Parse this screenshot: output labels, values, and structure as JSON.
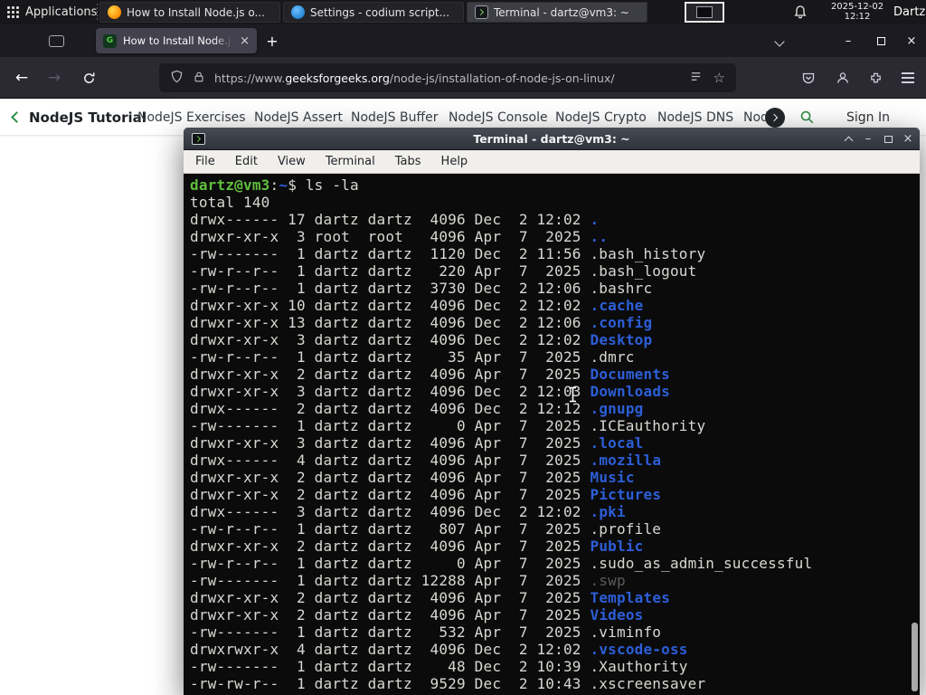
{
  "panel": {
    "applications": "Applications",
    "windows": [
      {
        "title": "How to Install Node.js o..."
      },
      {
        "title": "Settings - codium script..."
      },
      {
        "title": "Terminal - dartz@vm3: ~"
      }
    ],
    "date": "2025-12-02",
    "time": "12:12",
    "user": "Dartz"
  },
  "browser": {
    "tab": {
      "title": "How to Install Node.js on",
      "favicon_letter": "G"
    },
    "url": {
      "scheme": "https://www.",
      "domain": "geeksforgeeks.org",
      "path": "/node-js/installation-of-node-js-on-linux/"
    }
  },
  "site_nav": {
    "items": [
      "NodeJS Tutorial",
      "NodeJS Exercises",
      "NodeJS Assert",
      "NodeJS Buffer",
      "NodeJS Console",
      "NodeJS Crypto",
      "NodeJS DNS",
      "Node"
    ],
    "sign_in": "Sign In"
  },
  "terminal": {
    "title": "Terminal - dartz@vm3: ~",
    "menu": [
      "File",
      "Edit",
      "View",
      "Terminal",
      "Tabs",
      "Help"
    ],
    "lines": [
      [
        [
          "dartz@vm3",
          "g"
        ],
        [
          ":",
          ""
        ],
        [
          "~",
          "b"
        ],
        [
          "$ ls -la",
          ""
        ]
      ],
      [
        [
          "total 140",
          ""
        ]
      ],
      [
        [
          "drwx------ 17 dartz dartz  4096 Dec  2 12:02 ",
          ""
        ],
        [
          ".",
          "b"
        ]
      ],
      [
        [
          "drwxr-xr-x  3 root  root   4096 Apr  7  2025 ",
          ""
        ],
        [
          "..",
          "b"
        ]
      ],
      [
        [
          "-rw-------  1 dartz dartz  1120 Dec  2 11:56 .bash_history",
          ""
        ]
      ],
      [
        [
          "-rw-r--r--  1 dartz dartz   220 Apr  7  2025 .bash_logout",
          ""
        ]
      ],
      [
        [
          "-rw-r--r--  1 dartz dartz  3730 Dec  2 12:06 .bashrc",
          ""
        ]
      ],
      [
        [
          "drwxr-xr-x 10 dartz dartz  4096 Dec  2 12:02 ",
          ""
        ],
        [
          ".cache",
          "b"
        ]
      ],
      [
        [
          "drwxr-xr-x 13 dartz dartz  4096 Dec  2 12:06 ",
          ""
        ],
        [
          ".config",
          "b"
        ]
      ],
      [
        [
          "drwxr-xr-x  3 dartz dartz  4096 Dec  2 12:02 ",
          ""
        ],
        [
          "Desktop",
          "b"
        ]
      ],
      [
        [
          "-rw-r--r--  1 dartz dartz    35 Apr  7  2025 .dmrc",
          ""
        ]
      ],
      [
        [
          "drwxr-xr-x  2 dartz dartz  4096 Apr  7  2025 ",
          ""
        ],
        [
          "Documents",
          "b"
        ]
      ],
      [
        [
          "drwxr-xr-x  3 dartz dartz  4096 Dec  2 12:03 ",
          ""
        ],
        [
          "Downloads",
          "b"
        ]
      ],
      [
        [
          "drwx------  2 dartz dartz  4096 Dec  2 12:12 ",
          ""
        ],
        [
          ".gnupg",
          "b"
        ]
      ],
      [
        [
          "-rw-------  1 dartz dartz     0 Apr  7  2025 .ICEauthority",
          ""
        ]
      ],
      [
        [
          "drwxr-xr-x  3 dartz dartz  4096 Apr  7  2025 ",
          ""
        ],
        [
          ".local",
          "b"
        ]
      ],
      [
        [
          "drwx------  4 dartz dartz  4096 Apr  7  2025 ",
          ""
        ],
        [
          ".mozilla",
          "b"
        ]
      ],
      [
        [
          "drwxr-xr-x  2 dartz dartz  4096 Apr  7  2025 ",
          ""
        ],
        [
          "Music",
          "b"
        ]
      ],
      [
        [
          "drwxr-xr-x  2 dartz dartz  4096 Apr  7  2025 ",
          ""
        ],
        [
          "Pictures",
          "b"
        ]
      ],
      [
        [
          "drwx------  3 dartz dartz  4096 Dec  2 12:02 ",
          ""
        ],
        [
          ".pki",
          "b"
        ]
      ],
      [
        [
          "-rw-r--r--  1 dartz dartz   807 Apr  7  2025 .profile",
          ""
        ]
      ],
      [
        [
          "drwxr-xr-x  2 dartz dartz  4096 Apr  7  2025 ",
          ""
        ],
        [
          "Public",
          "b"
        ]
      ],
      [
        [
          "-rw-r--r--  1 dartz dartz     0 Apr  7  2025 .sudo_as_admin_successful",
          ""
        ]
      ],
      [
        [
          "-rw-------  1 dartz dartz 12288 Apr  7  2025 ",
          ""
        ],
        [
          ".swp",
          "d"
        ]
      ],
      [
        [
          "drwxr-xr-x  2 dartz dartz  4096 Apr  7  2025 ",
          ""
        ],
        [
          "Templates",
          "b"
        ]
      ],
      [
        [
          "drwxr-xr-x  2 dartz dartz  4096 Apr  7  2025 ",
          ""
        ],
        [
          "Videos",
          "b"
        ]
      ],
      [
        [
          "-rw-------  1 dartz dartz   532 Apr  7  2025 .viminfo",
          ""
        ]
      ],
      [
        [
          "drwxrwxr-x  4 dartz dartz  4096 Dec  2 12:02 ",
          ""
        ],
        [
          ".vscode-oss",
          "b"
        ]
      ],
      [
        [
          "-rw-------  1 dartz dartz    48 Dec  2 10:39 .Xauthority",
          ""
        ]
      ],
      [
        [
          "-rw-rw-r--  1 dartz dartz  9529 Dec  2 10:43 .xscreensaver",
          ""
        ]
      ]
    ]
  },
  "glyphs": {
    "plus": "+",
    "close": "×",
    "minimize": "–",
    "back": "←",
    "forward": "→",
    "star": "☆"
  },
  "colors": {
    "accent_green": "#2f8d46",
    "dir_blue": "#2d5ed7",
    "prompt_green": "#5fbe3c"
  }
}
